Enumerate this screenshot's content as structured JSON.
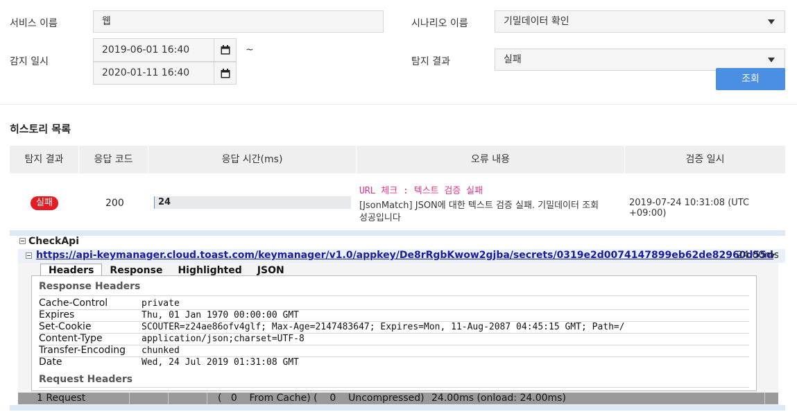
{
  "filters": {
    "service_label": "서비스 이름",
    "service_value": "웹",
    "detect_label": "감지 일시",
    "date_from": "2019-06-01 16:40",
    "date_to": "2020-01-11 16:40",
    "tilde": "~",
    "scenario_label": "시나리오 이름",
    "scenario_value": "기밀데이터 확인",
    "result_label": "탐지 결과",
    "result_value": "실패",
    "search_button": "조회"
  },
  "history": {
    "title": "히스토리 목록",
    "columns": [
      "탐지 결과",
      "응답 코드",
      "응답 시간(ms)",
      "오류 내용",
      "검증 일시"
    ],
    "row": {
      "status": "실패",
      "code": "200",
      "time_value": "24",
      "time_fraction": 0.005,
      "error_title": "URL 체크 : 텍스트 검증 실패",
      "error_detail_1": "[JsonMatch] JSON에 대한 텍스트 검증 실패. 기밀데이터 조회",
      "error_detail_2": "성공입니다",
      "verified_at": "2019-07-24 10:31:08 (UTC +09:00)"
    }
  },
  "detail": {
    "group": "CheckApi",
    "url": "https://api-keymanager.cloud.toast.com/keymanager/v1.0/appkey/De8rRgbKwow2gjba/secrets/0319e2d0074147899eb62de82960d55d",
    "duration": "24.00ms",
    "tabs": [
      "Headers",
      "Response",
      "Highlighted",
      "JSON"
    ],
    "response_headers_title": "Response Headers",
    "response_headers": [
      {
        "key": "Cache-Control",
        "value": "private"
      },
      {
        "key": "Expires",
        "value": "Thu, 01 Jan 1970 00:00:00 GMT"
      },
      {
        "key": "Set-Cookie",
        "value": "SCOUTER=z24ae86ofv4glf; Max-Age=2147483647; Expires=Mon, 11-Aug-2087 04:45:15 GMT; Path=/"
      },
      {
        "key": "Content-Type",
        "value": "application/json;charset=UTF-8"
      },
      {
        "key": "Transfer-Encoding",
        "value": "chunked"
      },
      {
        "key": "Date",
        "value": "Wed, 24 Jul 2019 01:31:08 GMT"
      }
    ],
    "request_headers_title": "Request Headers",
    "status_bar": {
      "requests": "1 Request",
      "cache": "(   0    From Cache) (    0    Uncompressed)",
      "timing": "24.00ms (onload: 24.00ms)"
    }
  },
  "icons": {
    "calendar": "calendar-icon",
    "dropdown": "caret-down-icon",
    "collapse": "collapse-icon"
  },
  "colors": {
    "primary": "#4a8fe2",
    "fail": "#e51c23",
    "error_text": "#e6338a",
    "link": "#1a1aa6"
  }
}
